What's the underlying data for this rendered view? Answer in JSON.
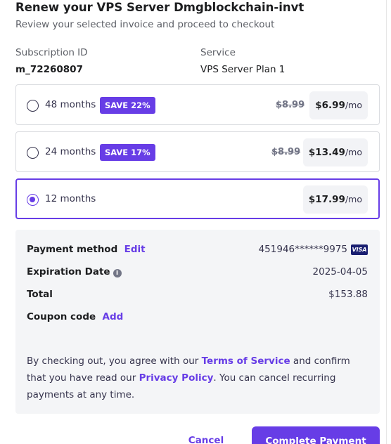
{
  "modal": {
    "title": "Renew your VPS Server Dmgblockchain-invt",
    "subtitle": "Review your selected invoice and proceed to checkout"
  },
  "meta": {
    "subscription_id_label": "Subscription ID",
    "subscription_id": "m_72260807",
    "service_label": "Service",
    "service": "VPS Server Plan 1"
  },
  "plans": [
    {
      "label": "48 months",
      "badge": "SAVE 22%",
      "old_price": "$8.99",
      "price": "$6.99",
      "per": "/mo",
      "selected": false
    },
    {
      "label": "24 months",
      "badge": "SAVE 17%",
      "old_price": "$8.99",
      "price": "$13.49",
      "per": "/mo",
      "selected": false
    },
    {
      "label": "12 months",
      "badge": "",
      "old_price": "",
      "price": "$17.99",
      "per": "/mo",
      "selected": true
    }
  ],
  "summary": {
    "payment_method_label": "Payment method",
    "edit_label": "Edit",
    "card_number": "451946******9975",
    "card_brand": "VISA",
    "expiration_label": "Expiration Date",
    "expiration_value": "2025-04-05",
    "total_label": "Total",
    "total_value": "$153.88",
    "coupon_label": "Coupon code",
    "coupon_add": "Add"
  },
  "legal": {
    "part1": "By checking out, you agree with our ",
    "terms_link": "Terms of Service",
    "part2": " and confirm that you have read our ",
    "privacy_link": "Privacy Policy",
    "part3": ". You can cancel recurring payments at any time."
  },
  "actions": {
    "cancel": "Cancel",
    "complete": "Complete Payment"
  },
  "colors": {
    "accent": "#673de6",
    "summary_bg": "#f4f5f7"
  }
}
